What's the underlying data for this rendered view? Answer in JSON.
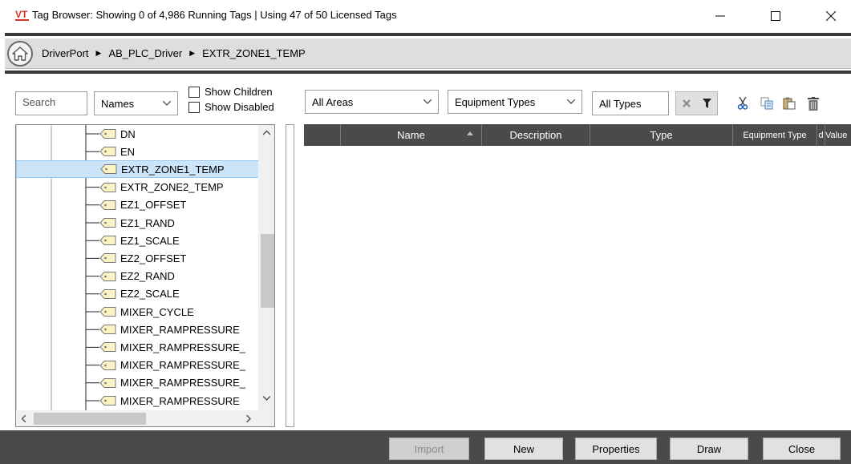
{
  "window": {
    "title": "Tag Browser: Showing 0 of 4,986 Running Tags | Using 47 of 50 Licensed Tags",
    "logo_text": "VT",
    "minimize": "—",
    "maximize": "☐",
    "close": "✕"
  },
  "breadcrumb": {
    "items": [
      "DriverPort",
      "AB_PLC_Driver",
      "EXTR_ZONE1_TEMP"
    ],
    "separator": "▶"
  },
  "toolbar": {
    "search_placeholder": "Search",
    "names_select": "Names",
    "show_children": "Show Children",
    "show_disabled": "Show Disabled",
    "areas_select": "All Areas",
    "equipment_select": "Equipment Types",
    "types_field": "All Types"
  },
  "tree": {
    "selected_index": 2,
    "items": [
      "DN",
      "EN",
      "EXTR_ZONE1_TEMP",
      "EXTR_ZONE2_TEMP",
      "EZ1_OFFSET",
      "EZ1_RAND",
      "EZ1_SCALE",
      "EZ2_OFFSET",
      "EZ2_RAND",
      "EZ2_SCALE",
      "MIXER_CYCLE",
      "MIXER_RAMPRESSURE",
      "MIXER_RAMPRESSURE_",
      "MIXER_RAMPRESSURE_",
      "MIXER_RAMPRESSURE_",
      "MIXER_RAMPRESSURE"
    ]
  },
  "grid": {
    "columns": [
      "Name",
      "Description",
      "Type",
      "Equipment Type",
      "d",
      "Value"
    ]
  },
  "buttons": {
    "import": "Import",
    "new": "New",
    "properties": "Properties",
    "draw": "Draw",
    "close": "Close"
  },
  "colors": {
    "dark_bar": "#4a4a4a",
    "selection": "#cce4f7",
    "logo_red": "#d9342b"
  }
}
